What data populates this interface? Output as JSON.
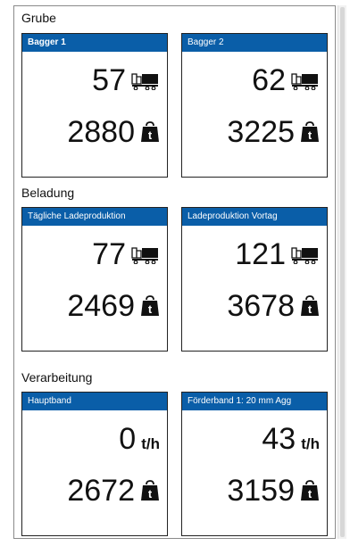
{
  "sections": [
    {
      "title": "Grube",
      "cards": [
        {
          "title": "Bagger 1",
          "bold": true,
          "top_value": "57",
          "top_unit": "truck-icon",
          "bottom_value": "2880",
          "bottom_unit": "weight-icon"
        },
        {
          "title": "Bagger 2",
          "bold": false,
          "top_value": "62",
          "top_unit": "truck-icon",
          "bottom_value": "3225",
          "bottom_unit": "weight-icon"
        }
      ]
    },
    {
      "title": "Beladung",
      "cards": [
        {
          "title": "Tägliche Ladeproduktion",
          "bold": false,
          "top_value": "77",
          "top_unit": "truck-icon",
          "bottom_value": "2469",
          "bottom_unit": "weight-icon"
        },
        {
          "title": "Ladeproduktion Vortag",
          "bold": false,
          "top_value": "121",
          "top_unit": "truck-icon",
          "bottom_value": "3678",
          "bottom_unit": "weight-icon"
        }
      ]
    },
    {
      "title": "Verarbeitung",
      "cards": [
        {
          "title": "Hauptband",
          "bold": false,
          "top_value": "0",
          "top_unit_text": "t/h",
          "bottom_value": "2672",
          "bottom_unit": "weight-icon"
        },
        {
          "title": "Förderband 1: 20 mm Agg",
          "bold": false,
          "top_value": "43",
          "top_unit_text": "t/h",
          "bottom_value": "3159",
          "bottom_unit": "weight-icon"
        }
      ]
    }
  ],
  "weight_icon_letter": "t",
  "colors": {
    "header": "#0a5ea8",
    "text": "#111111"
  }
}
